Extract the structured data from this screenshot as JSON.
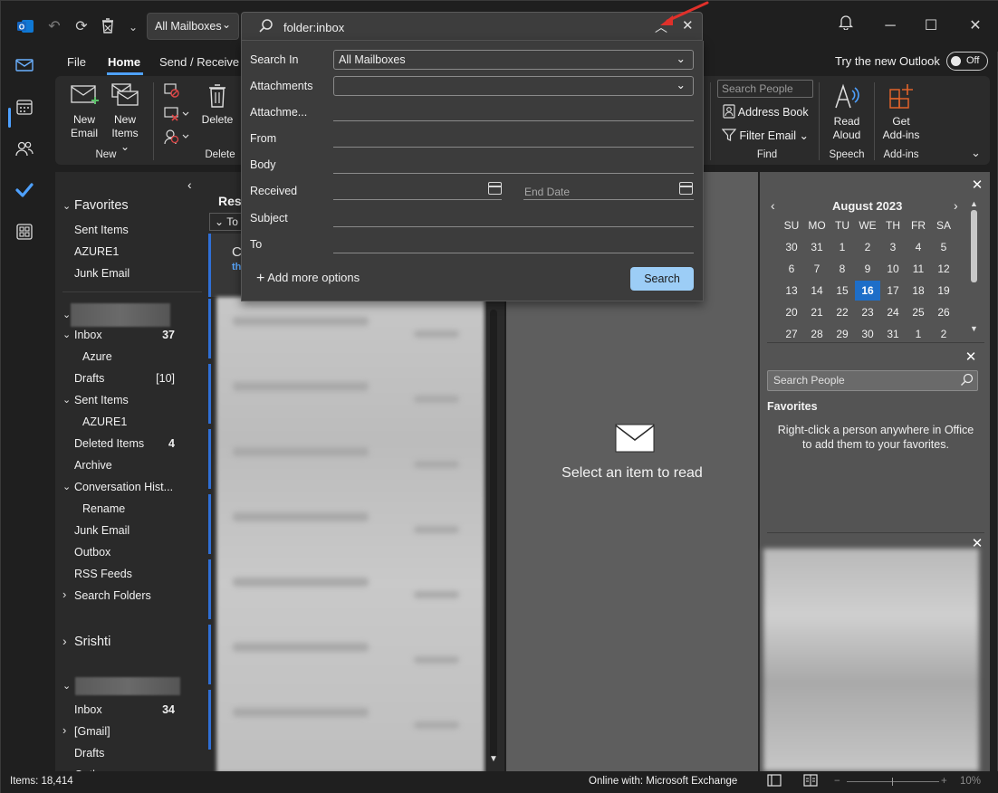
{
  "app": {
    "name": "Outlook"
  },
  "titlebar": {
    "mailbox_select": "All Mailboxes",
    "search_value": "folder:inbox"
  },
  "tabs": [
    "File",
    "Home",
    "Send / Receive"
  ],
  "try_new": {
    "label": "Try the new Outlook",
    "toggle": "Off"
  },
  "ribbon": {
    "new_email": [
      "New",
      "Email"
    ],
    "new_items": [
      "New",
      "Items"
    ],
    "delete": "Delete",
    "group_new": "New",
    "group_delete": "Delete",
    "search_people_placeholder": "Search People",
    "address_book": "Address Book",
    "filter_email": "Filter Email",
    "group_find": "Find",
    "read_aloud": [
      "Read",
      "Aloud"
    ],
    "group_speech": "Speech",
    "get_addins": [
      "Get",
      "Add-ins"
    ],
    "group_addins": "Add-ins"
  },
  "folders": {
    "favorites_head": "Favorites",
    "favorites": [
      "Sent Items",
      "AZURE1",
      "Junk Email"
    ],
    "account1_items": [
      {
        "label": "Inbox",
        "count": "37",
        "chev": "open"
      },
      {
        "label": "Azure",
        "count": ""
      },
      {
        "label": "Drafts",
        "count": "[10]"
      },
      {
        "label": "Sent Items",
        "count": "",
        "chev": "open"
      },
      {
        "label": "AZURE1",
        "count": ""
      },
      {
        "label": "Deleted Items",
        "count": "4"
      },
      {
        "label": "Archive",
        "count": ""
      },
      {
        "label": "Conversation Hist...",
        "count": "",
        "chev": "open"
      },
      {
        "label": "Rename",
        "count": ""
      },
      {
        "label": "Junk Email",
        "count": ""
      },
      {
        "label": "Outbox",
        "count": ""
      },
      {
        "label": "RSS Feeds",
        "count": ""
      },
      {
        "label": "Search Folders",
        "count": "",
        "chev": "closed"
      }
    ],
    "account2": "Srishti",
    "account3_items": [
      {
        "label": "Inbox",
        "count": "34"
      },
      {
        "label": "[Gmail]",
        "count": "",
        "chev": "closed"
      },
      {
        "label": "Drafts",
        "count": ""
      },
      {
        "label": "Outbox",
        "count": ""
      }
    ]
  },
  "msglist": {
    "header_partial": "Res",
    "sort_partial": "To",
    "row_partial_1": "C",
    "row_partial_2": "th"
  },
  "reading": {
    "empty_text": "Select an item to read"
  },
  "calendar": {
    "title": "August 2023",
    "dow": [
      "SU",
      "MO",
      "TU",
      "WE",
      "TH",
      "FR",
      "SA"
    ],
    "weeks": [
      [
        "30",
        "31",
        "1",
        "2",
        "3",
        "4",
        "5"
      ],
      [
        "6",
        "7",
        "8",
        "9",
        "10",
        "11",
        "12"
      ],
      [
        "13",
        "14",
        "15",
        "16",
        "17",
        "18",
        "19"
      ],
      [
        "20",
        "21",
        "22",
        "23",
        "24",
        "25",
        "26"
      ],
      [
        "27",
        "28",
        "29",
        "30",
        "31",
        "1",
        "2"
      ]
    ],
    "today": "16"
  },
  "people": {
    "search_placeholder": "Search People",
    "favorites_head": "Favorites",
    "favorites_text_1": "Right-click a person anywhere in Office",
    "favorites_text_2": "to add them to your favorites."
  },
  "search_panel": {
    "search_in_label": "Search In",
    "search_in_value": "All Mailboxes",
    "attachments_label": "Attachments",
    "attachment_name_label": "Attachme...",
    "from_label": "From",
    "body_label": "Body",
    "received_label": "Received",
    "end_date_placeholder": "End Date",
    "subject_label": "Subject",
    "to_label": "To",
    "add_more": "Add more options",
    "search_button": "Search"
  },
  "status": {
    "items": "Items: 18,414",
    "connection": "Online with: Microsoft Exchange",
    "zoom": "10%"
  },
  "colors": {
    "accent": "#4ea1ff",
    "today": "#1e6ec8",
    "search_button": "#9ccdf6",
    "annotation_arrow": "#e0302a"
  }
}
